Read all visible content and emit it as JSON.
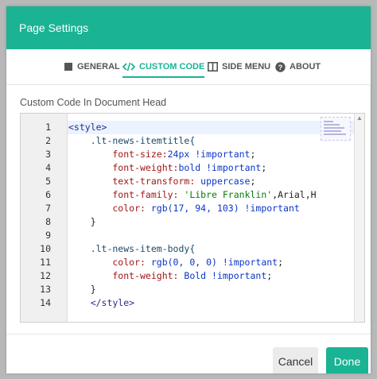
{
  "dialog": {
    "title": "Page Settings"
  },
  "tabs": [
    {
      "label": "GENERAL",
      "icon": "square-icon",
      "active": false
    },
    {
      "label": "CUSTOM CODE",
      "icon": "code-icon",
      "active": true
    },
    {
      "label": "SIDE MENU",
      "icon": "columns-icon",
      "active": false
    },
    {
      "label": "ABOUT",
      "icon": "question-circle-icon",
      "active": false
    }
  ],
  "section": {
    "label": "Custom Code In Document Head"
  },
  "editor": {
    "line_numbers": [
      "1",
      "2",
      "3",
      "4",
      "5",
      "6",
      "7",
      "8",
      "9",
      "10",
      "11",
      "12",
      "13",
      "14"
    ],
    "lines": [
      [
        {
          "t": "<style>",
          "c": "tag"
        }
      ],
      [
        {
          "t": "    .lt-news-itemtitle{",
          "c": "sel"
        }
      ],
      [
        {
          "t": "        font-size:",
          "c": "prop"
        },
        {
          "t": "24px !important",
          "c": "val"
        },
        {
          "t": ";",
          "c": "punc"
        }
      ],
      [
        {
          "t": "        font-weight:",
          "c": "prop"
        },
        {
          "t": "bold !important",
          "c": "val"
        },
        {
          "t": ";",
          "c": "punc"
        }
      ],
      [
        {
          "t": "        text-transform: ",
          "c": "prop"
        },
        {
          "t": "uppercase",
          "c": "val"
        },
        {
          "t": ";",
          "c": "punc"
        }
      ],
      [
        {
          "t": "        font-family: ",
          "c": "prop"
        },
        {
          "t": "'Libre Franklin'",
          "c": "str"
        },
        {
          "t": ",Arial,H",
          "c": "punc"
        }
      ],
      [
        {
          "t": "        color: ",
          "c": "prop"
        },
        {
          "t": "rgb(17, 94, 103) !important",
          "c": "val"
        }
      ],
      [
        {
          "t": "    }",
          "c": "punc"
        }
      ],
      [
        {
          "t": "",
          "c": "punc"
        }
      ],
      [
        {
          "t": "    .lt-news-item-body{",
          "c": "sel"
        }
      ],
      [
        {
          "t": "        color: ",
          "c": "prop"
        },
        {
          "t": "rgb(0, 0, 0) !important",
          "c": "val"
        },
        {
          "t": ";",
          "c": "punc"
        }
      ],
      [
        {
          "t": "        font-weight: ",
          "c": "prop"
        },
        {
          "t": "Bold !important",
          "c": "val"
        },
        {
          "t": ";",
          "c": "punc"
        }
      ],
      [
        {
          "t": "    }",
          "c": "punc"
        }
      ],
      [
        {
          "t": "    </style>",
          "c": "tag"
        }
      ]
    ]
  },
  "footer": {
    "cancel_label": "Cancel",
    "done_label": "Done"
  },
  "colors": {
    "accent": "#1ab394",
    "header_bg": "#1ab394"
  }
}
